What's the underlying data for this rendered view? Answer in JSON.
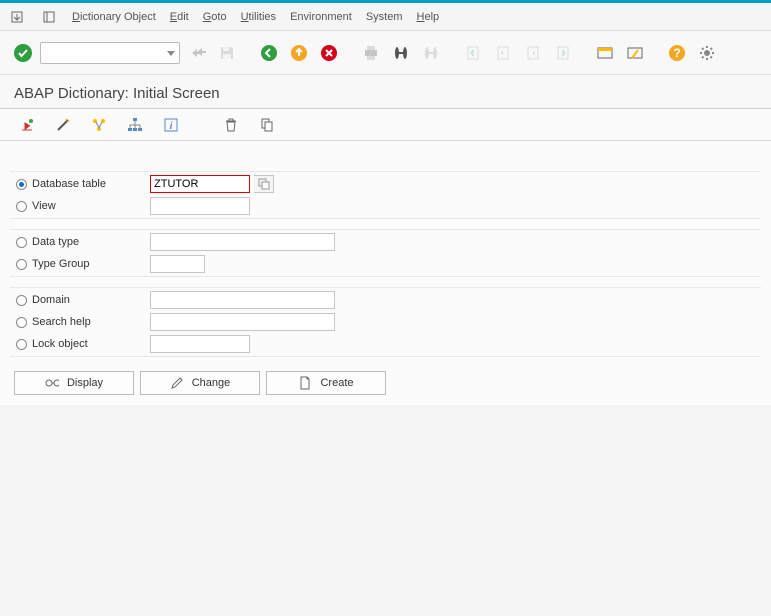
{
  "menu": {
    "dictionary_object": "Dictionary Object",
    "edit": "Edit",
    "goto": "Goto",
    "utilities": "Utilities",
    "environment": "Environment",
    "system": "System",
    "help": "Help"
  },
  "title": "ABAP Dictionary: Initial Screen",
  "command_value": "",
  "radios": {
    "database_table": "Database table",
    "view": "View",
    "data_type": "Data type",
    "type_group": "Type Group",
    "domain": "Domain",
    "search_help": "Search help",
    "lock_object": "Lock object"
  },
  "fields": {
    "database_table": "ZTUTOR",
    "view": "",
    "data_type": "",
    "type_group": "",
    "domain": "",
    "search_help": "",
    "lock_object": ""
  },
  "buttons": {
    "display": "Display",
    "change": "Change",
    "create": "Create"
  }
}
